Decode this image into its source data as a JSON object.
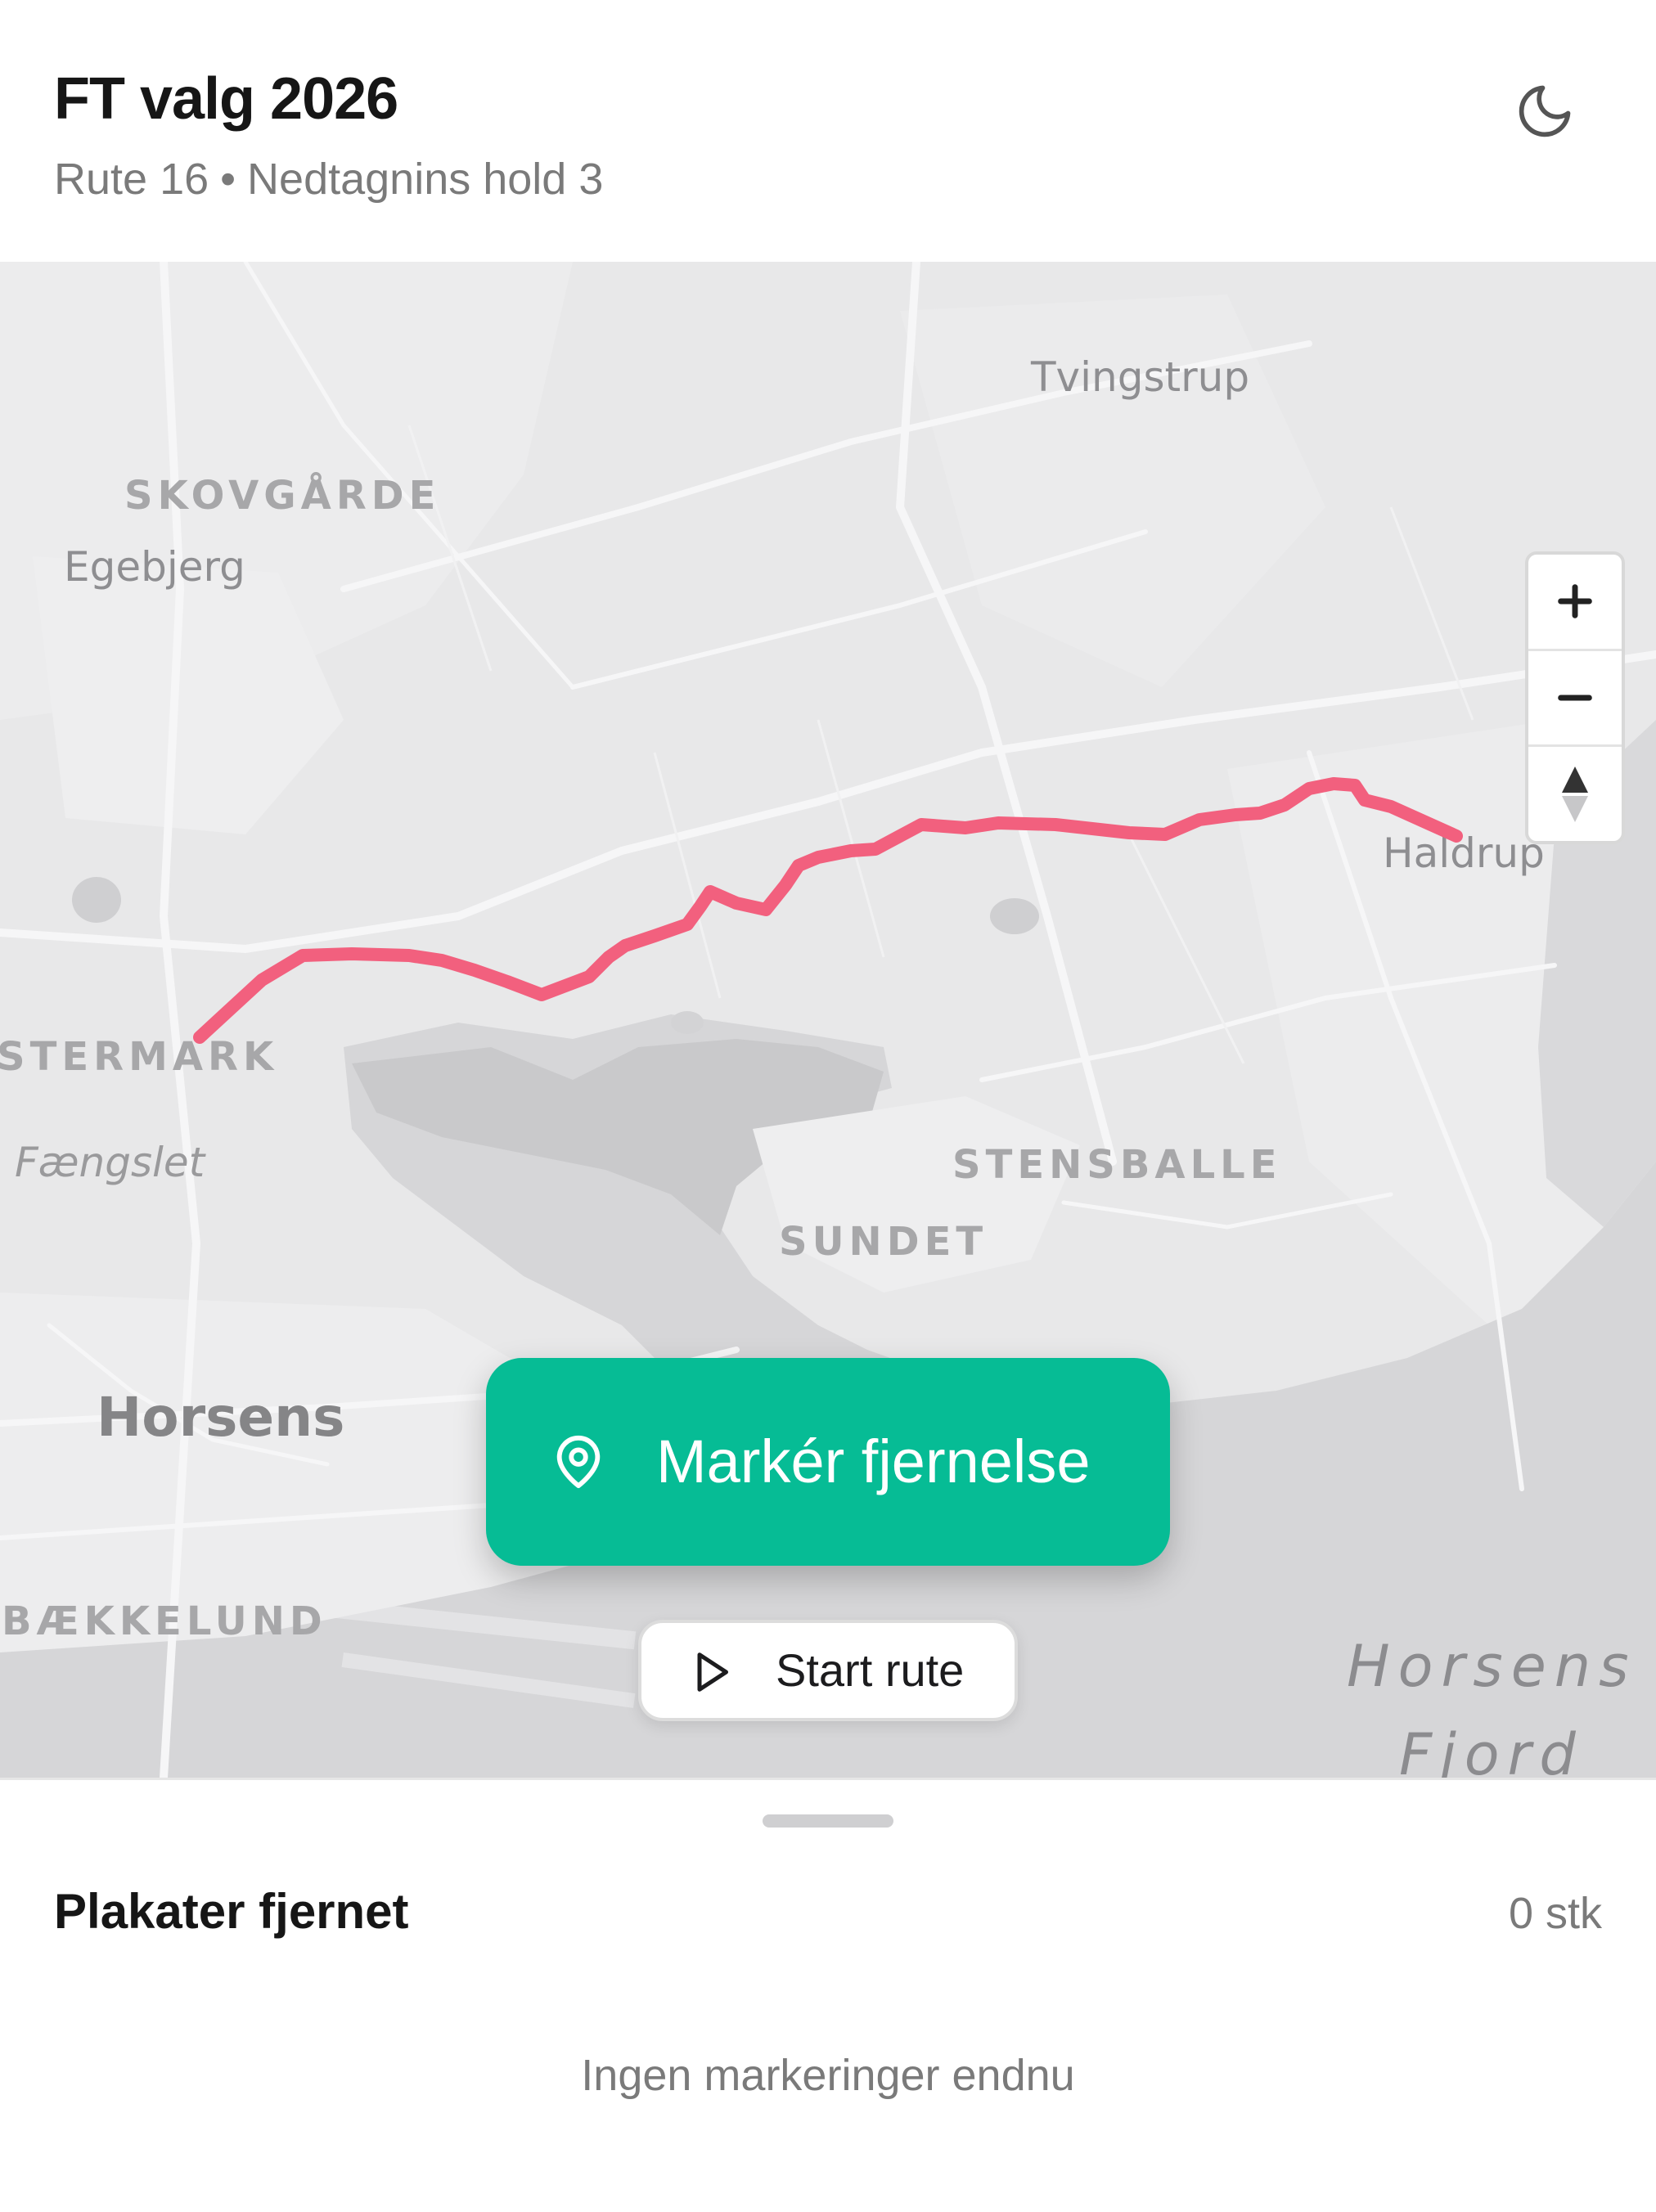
{
  "header": {
    "title": "FT valg 2026",
    "route": "Rute 16",
    "separator": "•",
    "team": "Nedtagnins hold 3",
    "theme_toggle_icon": "moon-icon"
  },
  "map": {
    "labels": {
      "skovgaarde": "SKOVGÅRDE",
      "egebjerg": "Egebjerg",
      "tvingstrup": "Tvingstrup",
      "haldrup": "Haldrup",
      "vestermark": "STERMARK",
      "faengslet": "Fængslet",
      "stensballe": "STENSBALLE",
      "sundet": "SUNDET",
      "horsens": "Horsens",
      "baekkelund": "BÆKKELUND",
      "fjord_line1": "Horsens",
      "fjord_line2": "Fjord"
    },
    "route_color": "#f2607e",
    "controls": {
      "zoom_in_icon": "plus-icon",
      "zoom_out_icon": "minus-icon",
      "compass_icon": "compass-icon",
      "info_icon": "info-icon"
    }
  },
  "actions": {
    "mark_removal_label": "Markér fjernelse",
    "mark_removal_icon": "map-pin-icon",
    "start_route_label": "Start rute",
    "start_route_icon": "play-icon",
    "accent_color": "#06bc95"
  },
  "sheet": {
    "title": "Plakater fjernet",
    "count": "0 stk",
    "empty_message": "Ingen markeringer endnu"
  }
}
